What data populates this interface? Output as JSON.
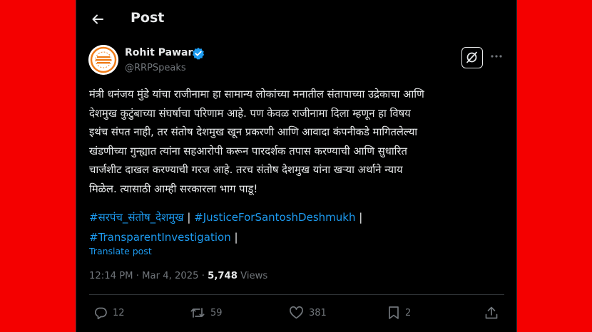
{
  "header": {
    "title": "Post"
  },
  "author": {
    "name": "Rohit Pawar",
    "handle": "@RRPSpeaks"
  },
  "post": {
    "lines": [
      "मंत्री धनंजय मुंडे यांचा राजीनामा हा सामान्य लोकांच्या मनातील संतापाच्या उद्रेकाचा आणि",
      "देशमुख कुटुंबाच्या संघर्षाचा परिणाम आहे. पण केवळ राजीनामा दिला म्हणून हा विषय",
      "इथंच संपत नाही, तर संतोष देशमुख खून प्रकरणी आणि आवादा कंपनीकडे मागितलेल्या",
      "खंडणीच्या गुन्ह्यात त्यांना सहआरोपी करून पारदर्शक तपास करण्याची आणि सुधारित",
      "चार्जशीट दाखल करण्याची गरज आहे. तरच संतोष देशमुख यांना खऱ्या अर्थाने न्याय",
      "मिळेल. त्यासाठी आम्ही सरकारला भाग पाडू!"
    ],
    "hashtags": [
      "#सरपंच_संतोष_देशमुख",
      "#JusticeForSantoshDeshmukh",
      "#TransparentInvestigation"
    ],
    "separator": "|",
    "translate_label": "Translate post"
  },
  "meta": {
    "time": "12:14 PM",
    "dot": "·",
    "date": "Mar 4, 2025",
    "views_count": "5,748",
    "views_label": "Views"
  },
  "actions": {
    "replies": "12",
    "reposts": "59",
    "likes": "381",
    "bookmarks": "2"
  },
  "colors": {
    "background_outer": "#f40000",
    "background_post": "#000000",
    "text_primary": "#e7e9ea",
    "text_secondary": "#71767b",
    "link": "#1d9bf0",
    "verified": "#1d9bf0",
    "avatar_accent": "#f07d1a"
  },
  "icons": {
    "back": "arrow-left-icon",
    "verified": "verified-badge-icon",
    "grok": "grok-icon",
    "more": "more-horizontal-icon",
    "reply": "reply-icon",
    "repost": "repost-icon",
    "like": "heart-icon",
    "bookmark": "bookmark-icon",
    "share": "share-icon"
  }
}
